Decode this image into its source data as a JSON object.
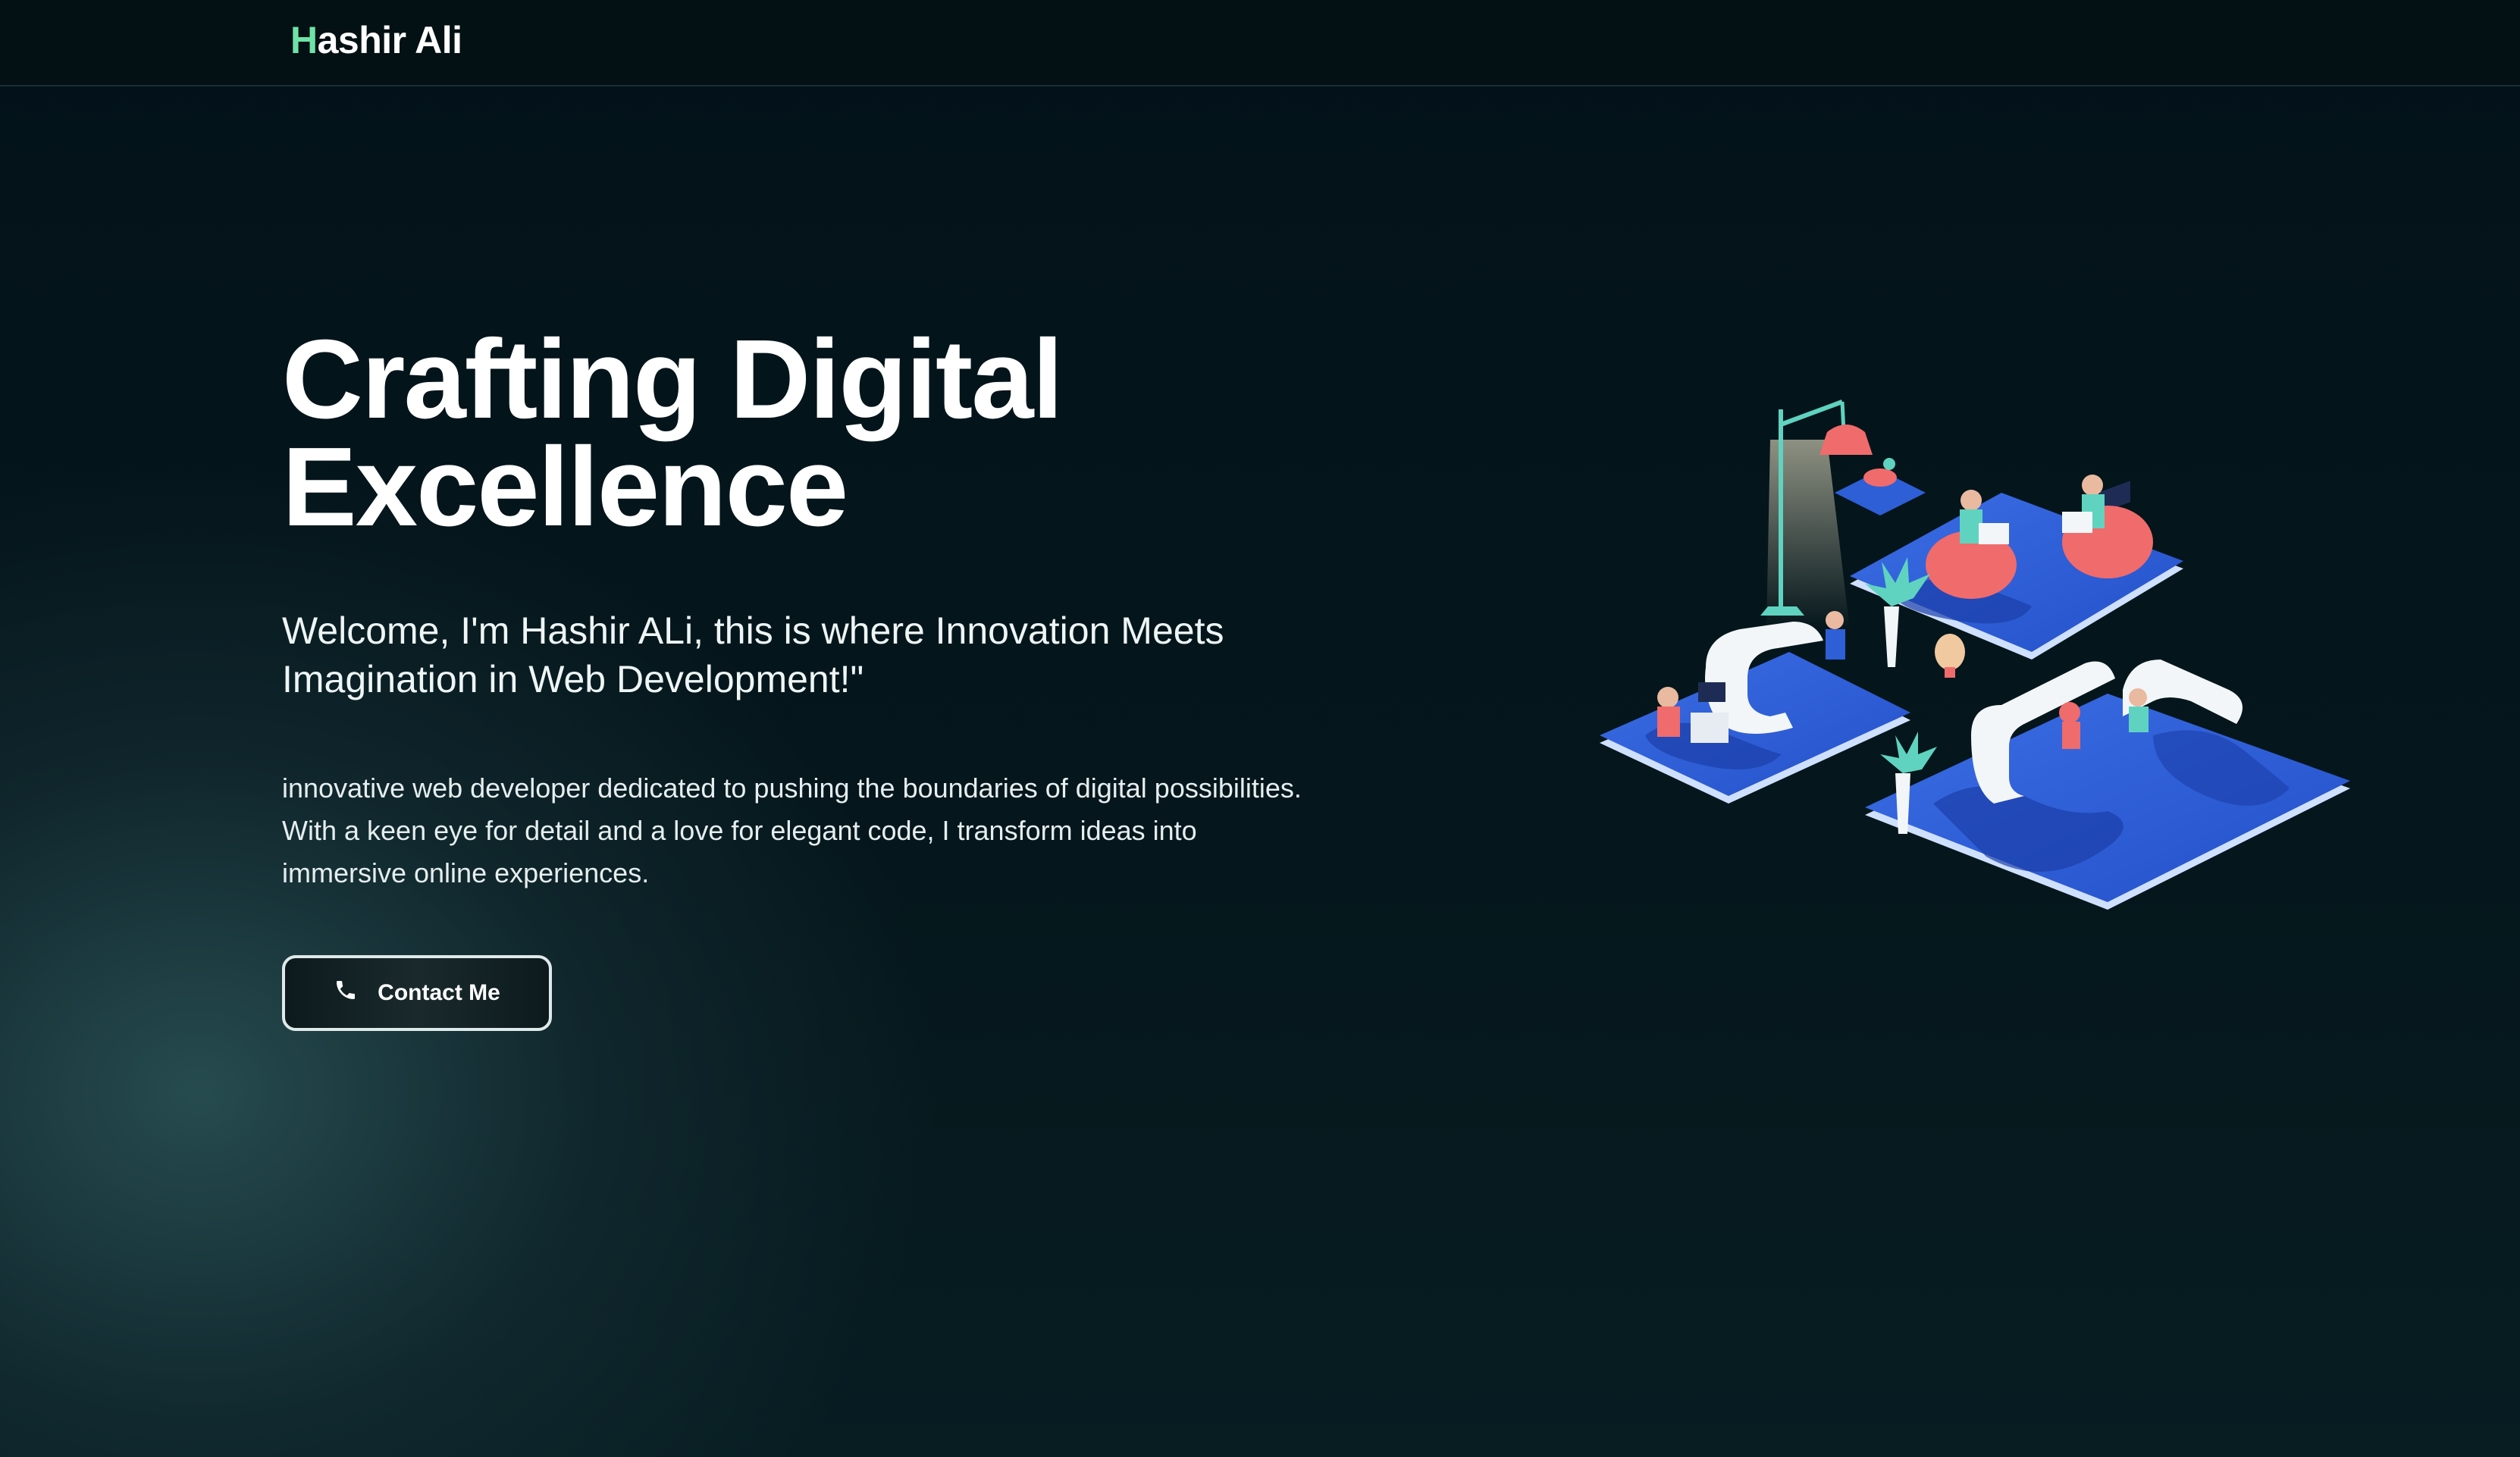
{
  "navbar": {
    "brand_initial": "H",
    "brand_rest": "ashir Ali"
  },
  "hero": {
    "title_line1": "Crafting Digital",
    "title_line2": "Excellence",
    "subtitle": "Welcome, I'm Hashir ALi, this is where Innovation Meets Imagination in Web Development!\"",
    "bio": "innovative web developer dedicated to pushing the boundaries of digital possibilities. With a keen eye for detail and a love for elegant code, I transform ideas into immersive online experiences.",
    "contact_button_label": "Contact Me",
    "contact_button_icon": "phone-icon"
  },
  "illustration": {
    "name": "isometric-office-illustration"
  },
  "colors": {
    "accent": "#6fe3a6",
    "background": "#04141a",
    "platform_blue": "#2f5fd6",
    "platform_dark": "#1b3ea8",
    "desk_white": "#f2f6f8",
    "figure_coral": "#f06b6b",
    "teal": "#5fd3c0"
  }
}
